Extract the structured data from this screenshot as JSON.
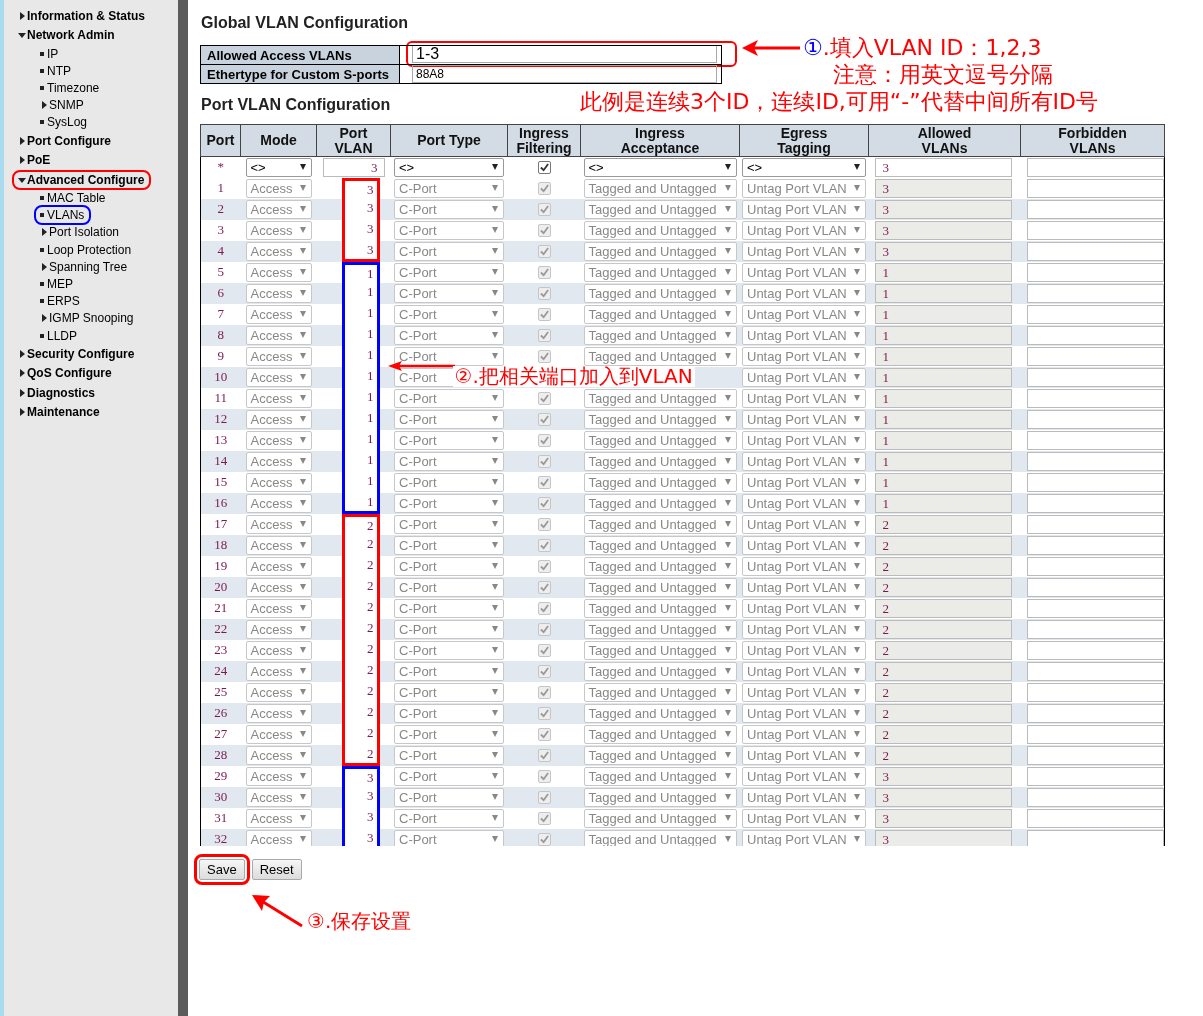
{
  "sidebar": {
    "items": [
      {
        "label": "Information & Status",
        "kind": "folder",
        "expanded": false
      },
      {
        "label": "Network Admin",
        "kind": "folder",
        "expanded": true,
        "children": [
          {
            "label": "IP",
            "kind": "page"
          },
          {
            "label": "NTP",
            "kind": "page"
          },
          {
            "label": "Timezone",
            "kind": "page"
          },
          {
            "label": "SNMP",
            "kind": "folder",
            "expanded": false
          },
          {
            "label": "SysLog",
            "kind": "page"
          }
        ]
      },
      {
        "label": "Port Configure",
        "kind": "folder",
        "expanded": false
      },
      {
        "label": "PoE",
        "kind": "folder",
        "expanded": false
      },
      {
        "label": "Advanced Configure",
        "kind": "folder",
        "expanded": true,
        "color": "#ff0000",
        "children": [
          {
            "label": "MAC Table",
            "kind": "page"
          },
          {
            "label": "VLANs",
            "kind": "page",
            "color": "#0000ff"
          },
          {
            "label": "Port Isolation",
            "kind": "folder",
            "expanded": false
          },
          {
            "label": "Loop Protection",
            "kind": "page"
          },
          {
            "label": "Spanning Tree",
            "kind": "folder",
            "expanded": false
          },
          {
            "label": "MEP",
            "kind": "page"
          },
          {
            "label": "ERPS",
            "kind": "page"
          },
          {
            "label": "IGMP Snooping",
            "kind": "folder",
            "expanded": false
          },
          {
            "label": "LLDP",
            "kind": "page"
          }
        ]
      },
      {
        "label": "Security Configure",
        "kind": "folder",
        "expanded": false
      },
      {
        "label": "QoS Configure",
        "kind": "folder",
        "expanded": false
      },
      {
        "label": "Diagnostics",
        "kind": "folder",
        "expanded": false
      },
      {
        "label": "Maintenance",
        "kind": "folder",
        "expanded": false
      }
    ]
  },
  "global": {
    "title": "Global VLAN Configuration",
    "fields": [
      {
        "label": "Allowed Access VLANs",
        "value": "1-3",
        "color": "#ff0000"
      },
      {
        "label": "Ethertype for Custom S-ports",
        "value": "88A8"
      }
    ]
  },
  "port_config": {
    "title": "Port VLAN Configuration",
    "columns": [
      [
        "Port"
      ],
      [
        "Mode"
      ],
      [
        "Port",
        "VLAN"
      ],
      [
        "Port Type"
      ],
      [
        "Ingress",
        "Filtering"
      ],
      [
        "Ingress",
        "Acceptance"
      ],
      [
        "Egress",
        "Tagging"
      ],
      [
        "Allowed",
        "VLANs"
      ],
      [
        "Forbidden",
        "VLANs"
      ]
    ],
    "defaults_row": {
      "port": "*",
      "mode": "<>",
      "port_vlan": "3",
      "port_type": "<>",
      "ingress_filtering": true,
      "ingress_acceptance": "<>",
      "egress_tagging": "<>",
      "allowed_vlans": "3",
      "disabled": false
    },
    "rows": [
      {
        "port": "1",
        "mode": "Access",
        "port_vlan": "3",
        "color": "#ff0000",
        "port_type": "C-Port",
        "ingress_filtering": true,
        "ingress_acceptance": "Tagged and Untagged",
        "egress_tagging": "Untag Port VLAN",
        "allowed_vlans": "3",
        "disabled": true
      },
      {
        "port": "2",
        "mode": "Access",
        "port_vlan": "3",
        "color": "#ff0000",
        "port_type": "C-Port",
        "ingress_filtering": true,
        "ingress_acceptance": "Tagged and Untagged",
        "egress_tagging": "Untag Port VLAN",
        "allowed_vlans": "3",
        "disabled": true
      },
      {
        "port": "3",
        "mode": "Access",
        "port_vlan": "3",
        "color": "#ff0000",
        "port_type": "C-Port",
        "ingress_filtering": true,
        "ingress_acceptance": "Tagged and Untagged",
        "egress_tagging": "Untag Port VLAN",
        "allowed_vlans": "3",
        "disabled": true
      },
      {
        "port": "4",
        "mode": "Access",
        "port_vlan": "3",
        "color": "#ff0000",
        "port_type": "C-Port",
        "ingress_filtering": true,
        "ingress_acceptance": "Tagged and Untagged",
        "egress_tagging": "Untag Port VLAN",
        "allowed_vlans": "3",
        "disabled": true
      },
      {
        "port": "5",
        "mode": "Access",
        "port_vlan": "1",
        "color": "#0000ff",
        "port_type": "C-Port",
        "ingress_filtering": true,
        "ingress_acceptance": "Tagged and Untagged",
        "egress_tagging": "Untag Port VLAN",
        "allowed_vlans": "1",
        "disabled": true
      },
      {
        "port": "6",
        "mode": "Access",
        "port_vlan": "1",
        "color": "#0000ff",
        "port_type": "C-Port",
        "ingress_filtering": true,
        "ingress_acceptance": "Tagged and Untagged",
        "egress_tagging": "Untag Port VLAN",
        "allowed_vlans": "1",
        "disabled": true
      },
      {
        "port": "7",
        "mode": "Access",
        "port_vlan": "1",
        "color": "#0000ff",
        "port_type": "C-Port",
        "ingress_filtering": true,
        "ingress_acceptance": "Tagged and Untagged",
        "egress_tagging": "Untag Port VLAN",
        "allowed_vlans": "1",
        "disabled": true
      },
      {
        "port": "8",
        "mode": "Access",
        "port_vlan": "1",
        "color": "#0000ff",
        "port_type": "C-Port",
        "ingress_filtering": true,
        "ingress_acceptance": "Tagged and Untagged",
        "egress_tagging": "Untag Port VLAN",
        "allowed_vlans": "1",
        "disabled": true
      },
      {
        "port": "9",
        "mode": "Access",
        "port_vlan": "1",
        "color": "#0000ff",
        "port_type": "C-Port",
        "ingress_filtering": true,
        "ingress_acceptance": "Tagged and Untagged",
        "egress_tagging": "Untag Port VLAN",
        "allowed_vlans": "1",
        "disabled": true
      },
      {
        "port": "10",
        "mode": "Access",
        "port_vlan": "1",
        "color": "#0000ff",
        "port_type": "C-Port",
        "note": {
          "marker": "②",
          "color": "#ff0000",
          "text": ".把相关端口加入到VLAN"
        },
        "egress_tagging": "Untag Port VLAN",
        "allowed_vlans": "1",
        "disabled": true
      },
      {
        "port": "11",
        "mode": "Access",
        "port_vlan": "1",
        "color": "#0000ff",
        "port_type": "C-Port",
        "ingress_filtering": true,
        "ingress_acceptance": "Tagged and Untagged",
        "egress_tagging": "Untag Port VLAN",
        "allowed_vlans": "1",
        "disabled": true
      },
      {
        "port": "12",
        "mode": "Access",
        "port_vlan": "1",
        "color": "#0000ff",
        "port_type": "C-Port",
        "ingress_filtering": true,
        "ingress_acceptance": "Tagged and Untagged",
        "egress_tagging": "Untag Port VLAN",
        "allowed_vlans": "1",
        "disabled": true
      },
      {
        "port": "13",
        "mode": "Access",
        "port_vlan": "1",
        "color": "#0000ff",
        "port_type": "C-Port",
        "ingress_filtering": true,
        "ingress_acceptance": "Tagged and Untagged",
        "egress_tagging": "Untag Port VLAN",
        "allowed_vlans": "1",
        "disabled": true
      },
      {
        "port": "14",
        "mode": "Access",
        "port_vlan": "1",
        "color": "#0000ff",
        "port_type": "C-Port",
        "ingress_filtering": true,
        "ingress_acceptance": "Tagged and Untagged",
        "egress_tagging": "Untag Port VLAN",
        "allowed_vlans": "1",
        "disabled": true
      },
      {
        "port": "15",
        "mode": "Access",
        "port_vlan": "1",
        "color": "#0000ff",
        "port_type": "C-Port",
        "ingress_filtering": true,
        "ingress_acceptance": "Tagged and Untagged",
        "egress_tagging": "Untag Port VLAN",
        "allowed_vlans": "1",
        "disabled": true
      },
      {
        "port": "16",
        "mode": "Access",
        "port_vlan": "1",
        "color": "#0000ff",
        "port_type": "C-Port",
        "ingress_filtering": true,
        "ingress_acceptance": "Tagged and Untagged",
        "egress_tagging": "Untag Port VLAN",
        "allowed_vlans": "1",
        "disabled": true
      },
      {
        "port": "17",
        "mode": "Access",
        "port_vlan": "2",
        "color": "#ff0000",
        "port_type": "C-Port",
        "ingress_filtering": true,
        "ingress_acceptance": "Tagged and Untagged",
        "egress_tagging": "Untag Port VLAN",
        "allowed_vlans": "2",
        "disabled": true
      },
      {
        "port": "18",
        "mode": "Access",
        "port_vlan": "2",
        "color": "#ff0000",
        "port_type": "C-Port",
        "ingress_filtering": true,
        "ingress_acceptance": "Tagged and Untagged",
        "egress_tagging": "Untag Port VLAN",
        "allowed_vlans": "2",
        "disabled": true
      },
      {
        "port": "19",
        "mode": "Access",
        "port_vlan": "2",
        "color": "#ff0000",
        "port_type": "C-Port",
        "ingress_filtering": true,
        "ingress_acceptance": "Tagged and Untagged",
        "egress_tagging": "Untag Port VLAN",
        "allowed_vlans": "2",
        "disabled": true
      },
      {
        "port": "20",
        "mode": "Access",
        "port_vlan": "2",
        "color": "#ff0000",
        "port_type": "C-Port",
        "ingress_filtering": true,
        "ingress_acceptance": "Tagged and Untagged",
        "egress_tagging": "Untag Port VLAN",
        "allowed_vlans": "2",
        "disabled": true
      },
      {
        "port": "21",
        "mode": "Access",
        "port_vlan": "2",
        "color": "#ff0000",
        "port_type": "C-Port",
        "ingress_filtering": true,
        "ingress_acceptance": "Tagged and Untagged",
        "egress_tagging": "Untag Port VLAN",
        "allowed_vlans": "2",
        "disabled": true
      },
      {
        "port": "22",
        "mode": "Access",
        "port_vlan": "2",
        "color": "#ff0000",
        "port_type": "C-Port",
        "ingress_filtering": true,
        "ingress_acceptance": "Tagged and Untagged",
        "egress_tagging": "Untag Port VLAN",
        "allowed_vlans": "2",
        "disabled": true
      },
      {
        "port": "23",
        "mode": "Access",
        "port_vlan": "2",
        "color": "#ff0000",
        "port_type": "C-Port",
        "ingress_filtering": true,
        "ingress_acceptance": "Tagged and Untagged",
        "egress_tagging": "Untag Port VLAN",
        "allowed_vlans": "2",
        "disabled": true
      },
      {
        "port": "24",
        "mode": "Access",
        "port_vlan": "2",
        "color": "#ff0000",
        "port_type": "C-Port",
        "ingress_filtering": true,
        "ingress_acceptance": "Tagged and Untagged",
        "egress_tagging": "Untag Port VLAN",
        "allowed_vlans": "2",
        "disabled": true
      },
      {
        "port": "25",
        "mode": "Access",
        "port_vlan": "2",
        "color": "#ff0000",
        "port_type": "C-Port",
        "ingress_filtering": true,
        "ingress_acceptance": "Tagged and Untagged",
        "egress_tagging": "Untag Port VLAN",
        "allowed_vlans": "2",
        "disabled": true
      },
      {
        "port": "26",
        "mode": "Access",
        "port_vlan": "2",
        "color": "#ff0000",
        "port_type": "C-Port",
        "ingress_filtering": true,
        "ingress_acceptance": "Tagged and Untagged",
        "egress_tagging": "Untag Port VLAN",
        "allowed_vlans": "2",
        "disabled": true
      },
      {
        "port": "27",
        "mode": "Access",
        "port_vlan": "2",
        "color": "#ff0000",
        "port_type": "C-Port",
        "ingress_filtering": true,
        "ingress_acceptance": "Tagged and Untagged",
        "egress_tagging": "Untag Port VLAN",
        "allowed_vlans": "2",
        "disabled": true
      },
      {
        "port": "28",
        "mode": "Access",
        "port_vlan": "2",
        "color": "#ff0000",
        "port_type": "C-Port",
        "ingress_filtering": true,
        "ingress_acceptance": "Tagged and Untagged",
        "egress_tagging": "Untag Port VLAN",
        "allowed_vlans": "2",
        "disabled": true
      },
      {
        "port": "29",
        "mode": "Access",
        "port_vlan": "3",
        "color": "#0000ff",
        "port_type": "C-Port",
        "ingress_filtering": true,
        "ingress_acceptance": "Tagged and Untagged",
        "egress_tagging": "Untag Port VLAN",
        "allowed_vlans": "3",
        "disabled": true
      },
      {
        "port": "30",
        "mode": "Access",
        "port_vlan": "3",
        "color": "#0000ff",
        "port_type": "C-Port",
        "ingress_filtering": true,
        "ingress_acceptance": "Tagged and Untagged",
        "egress_tagging": "Untag Port VLAN",
        "allowed_vlans": "3",
        "disabled": true
      },
      {
        "port": "31",
        "mode": "Access",
        "port_vlan": "3",
        "color": "#0000ff",
        "port_type": "C-Port",
        "ingress_filtering": true,
        "ingress_acceptance": "Tagged and Untagged",
        "egress_tagging": "Untag Port VLAN",
        "allowed_vlans": "3",
        "disabled": true
      },
      {
        "port": "32",
        "mode": "Access",
        "port_vlan": "3",
        "color": "#0000ff",
        "port_type": "C-Port",
        "ingress_filtering": true,
        "ingress_acceptance": "Tagged and Untagged",
        "egress_tagging": "Untag Port VLAN",
        "allowed_vlans": "3",
        "disabled": true
      }
    ]
  },
  "buttons": [
    {
      "label": "Save",
      "color": "#ff0000"
    },
    {
      "label": "Reset"
    }
  ],
  "callouts": [
    {
      "marker": "①",
      "color": "#0000ff",
      "lines": [
        ".填入VLAN ID：1,2,3",
        "注意：用英文逗号分隔",
        "此例是连续3个ID，连续ID,可用“-”代替中间所有ID号"
      ]
    },
    {
      "marker": "③",
      "color": "#ff0000",
      "lines": [
        ".保存设置"
      ]
    }
  ]
}
